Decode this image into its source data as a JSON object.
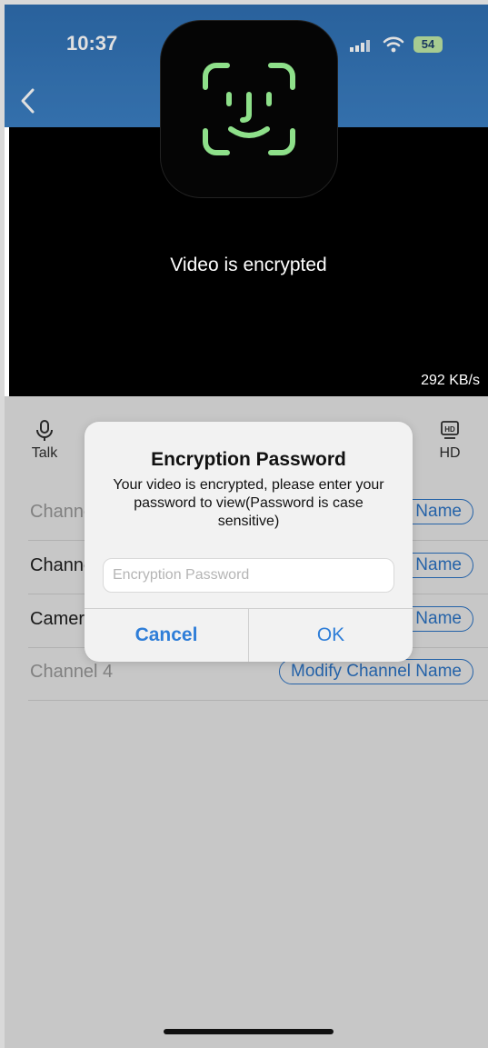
{
  "status_bar": {
    "time": "10:37",
    "battery": "54"
  },
  "video": {
    "message": "Video is encrypted",
    "bitrate": "292 KB/s"
  },
  "controls": {
    "talk_label": "Talk",
    "hd_label": "HD"
  },
  "channels": [
    {
      "name": "Channel 1",
      "button": "Modify Channel Name",
      "muted": true
    },
    {
      "name": "Channel 2",
      "button": "Modify Channel Name",
      "muted": false
    },
    {
      "name": "Camera 3",
      "button": "Modify Channel Name",
      "muted": false
    },
    {
      "name": "Channel 4",
      "button": "Modify Channel Name",
      "muted": true
    }
  ],
  "dialog": {
    "title": "Encryption Password",
    "message": "Your video is encrypted, please enter your password to view(Password is case sensitive)",
    "input_placeholder": "Encryption Password",
    "cancel_label": "Cancel",
    "ok_label": "OK"
  },
  "colors": {
    "header": "#3c80c4",
    "accent": "#2f7ed8",
    "faceid": "#8ee08a"
  }
}
